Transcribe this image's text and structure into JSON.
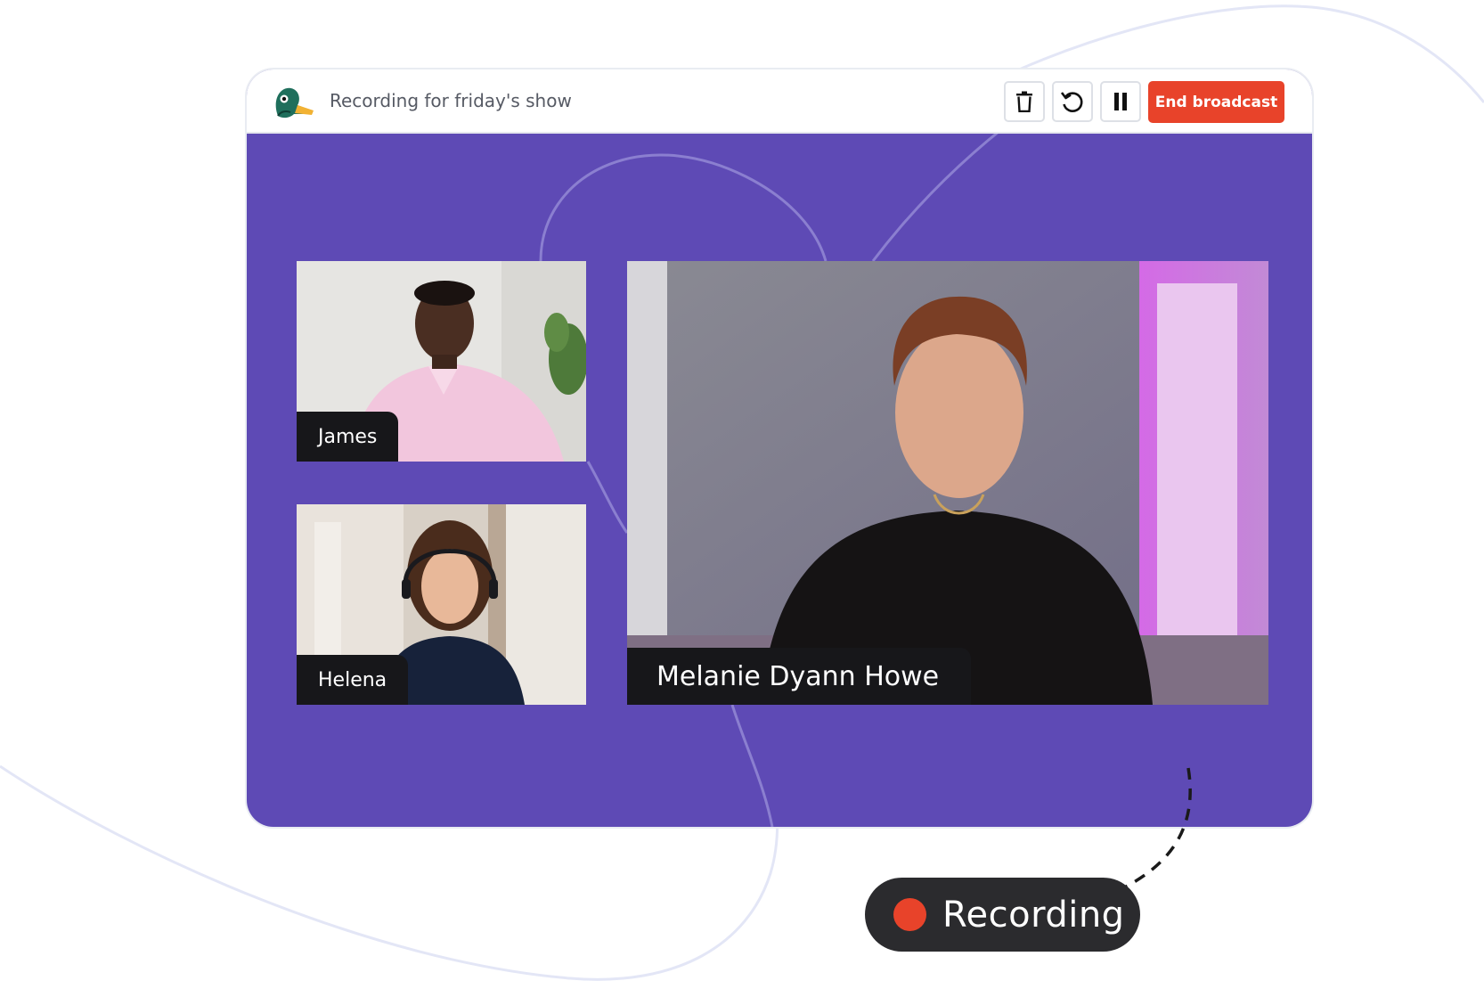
{
  "window": {
    "title": "Recording for friday's show",
    "logo_icon": "duck-logo-icon"
  },
  "toolbar": {
    "delete_icon": "trash-icon",
    "restart_icon": "restart-icon",
    "pause_icon": "pause-icon",
    "end_label": "End broadcast"
  },
  "participants": [
    {
      "name": "James"
    },
    {
      "name": "Helena"
    },
    {
      "name": "Melanie Dyann Howe"
    }
  ],
  "status": {
    "label": "Recording",
    "dot_color": "#e8432a"
  },
  "colors": {
    "stage": "#5e4ab5",
    "accent": "#e8432a",
    "pill": "#2b2b2e",
    "tag": "#17171a"
  }
}
